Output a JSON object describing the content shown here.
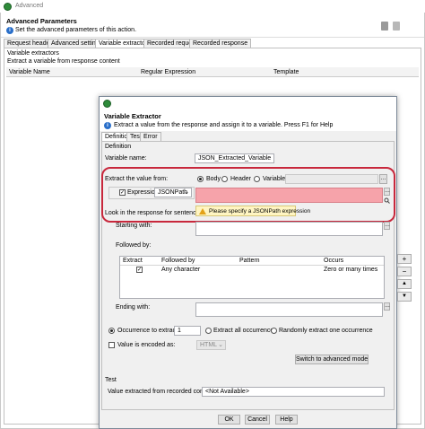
{
  "bg_window": {
    "title": "Advanced",
    "header_title": "Advanced Parameters",
    "header_subtitle": "Set the advanced parameters of this action.",
    "tabs": [
      "Request headers",
      "Advanced settings",
      "Variable extractors",
      "Recorded request",
      "Recorded response"
    ],
    "section_title": "Variable extractors",
    "section_subtitle": "Extract a variable from response content",
    "table_headers": [
      "Variable Name",
      "Regular Expression",
      "Template"
    ]
  },
  "dialog": {
    "title": "Variable Extractor",
    "subtitle": "Extract a value from the response and assign it to a variable. Press F1 for Help",
    "tabs": [
      "Definition",
      "Test",
      "Error"
    ],
    "definition_label": "Definition",
    "variable_name_label": "Variable name:",
    "variable_name_value": "JSON_Extracted_Variable",
    "extract_from_label": "Extract the value from:",
    "source_options": [
      "Body",
      "Header",
      "Variable"
    ],
    "look_in_label": "Look in the response for sentence:",
    "expression_checkbox": "Expression",
    "expression_type": "JSONPath",
    "warning_text": "Please specify a JSONPath expression",
    "starting_with_label": "Starting with:",
    "followed_by_label": "Followed by:",
    "followed_table": {
      "headers": [
        "Extract",
        "Followed by",
        "Pattern",
        "Occurs"
      ],
      "rows": [
        {
          "extract": "✓",
          "followed_by": "Any character",
          "pattern": "",
          "occurs": "Zero or many times"
        }
      ]
    },
    "ending_with_label": "Ending with:",
    "occurrence_label": "Occurrence to extract:",
    "occurrence_value": "1",
    "extract_all_label": "Extract all occurrences",
    "random_label": "Randomly extract one occurrence",
    "encoded_label": "Value is encoded as:",
    "encoded_value": "HTML",
    "switch_button": "Switch to advanced mode",
    "test_section_label": "Test",
    "recorded_value_label": "Value extracted from recorded content:",
    "recorded_value": "<Not Available>",
    "ok_button": "OK",
    "cancel_button": "Cancel",
    "help_button": "Help"
  },
  "colors": {
    "highlight_border": "#c8283c",
    "error_field": "#f6a3aa",
    "warning_bg": "#fff5c2",
    "accent_green": "#2e8b3a"
  }
}
